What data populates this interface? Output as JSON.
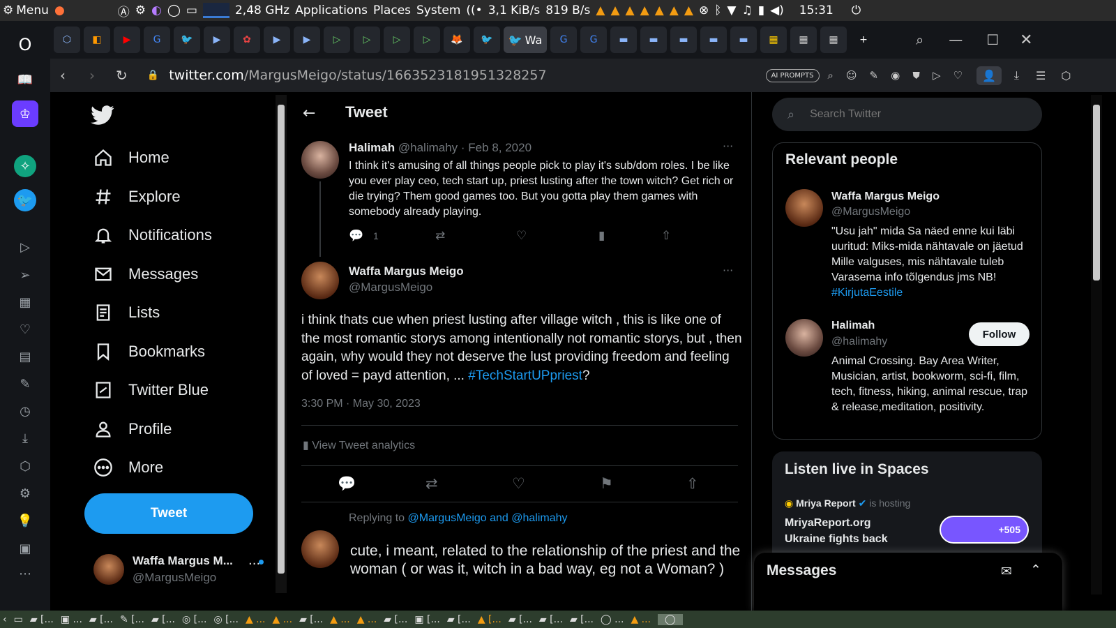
{
  "system_bar": {
    "menu": "Menu",
    "cpu": "2,48 GHz",
    "applications": "Applications",
    "places": "Places",
    "system": "System",
    "net_down": "3,1 KiB/s",
    "net_up": "819 B/s",
    "clock": "15:31"
  },
  "browser": {
    "url_host": "twitter.com",
    "url_path": "/MargusMeigo/status/1663523181951328257",
    "ai_prompts": "AI PROMPTS",
    "active_tab_title": "Wa"
  },
  "nav": {
    "items": [
      "Home",
      "Explore",
      "Notifications",
      "Messages",
      "Lists",
      "Bookmarks",
      "Twitter Blue",
      "Profile",
      "More"
    ],
    "tweet_button": "Tweet",
    "account_name": "Waffa Margus M...",
    "account_handle": "@MargusMeigo"
  },
  "header": {
    "title": "Tweet"
  },
  "parent_tweet": {
    "name": "Halimah",
    "handle": "@halimahy",
    "date": "Feb 8, 2020",
    "text": "I think it's amusing of all things people pick to play it's sub/dom roles. I be like you ever play ceo, tech start up, priest lusting after the town witch? Get rich or die trying? Them good games too. But you gotta play them games with somebody already playing.",
    "reply_count": "1"
  },
  "main_tweet": {
    "name": "Waffa Margus Meigo",
    "handle": "@MargusMeigo",
    "text": "i think thats cue when priest lusting after village witch , this is like one of the most romantic storys among intentionally not romantic storys, but , then again, why would they not deserve the lust providing freedom and feeling of loved = payd attention, ... ",
    "hashtag": "#TechStartUPpriest",
    "text_end": "?",
    "time": "3:30 PM · May 30, 2023",
    "analytics": "View Tweet analytics"
  },
  "reply": {
    "replying_to": "Replying to",
    "mentions": "@MargusMeigo and @halimahy",
    "draft": "cute, i meant, related to the relationship of the priest and the woman ( or was it, witch in a bad way, eg not a Woman? )"
  },
  "search": {
    "placeholder": "Search Twitter"
  },
  "relevant": {
    "title": "Relevant people",
    "people": [
      {
        "name": "Waffa Margus Meigo",
        "handle": "@MargusMeigo",
        "bio": "\"Usu jah\" mida Sa näed enne kui läbi uuritud: Miks-mida nähtavale on jäetud Mille valguses, mis nähtavale tuleb Varasema info tõlgendus jms NB! ",
        "bio_tag": "#KirjutaEestile"
      },
      {
        "name": "Halimah",
        "handle": "@halimahy",
        "follow": "Follow",
        "bio": "Animal Crossing. Bay Area Writer, Musician, artist, bookworm, sci-fi, film, tech, fitness, hiking, animal rescue, trap & release,meditation, positivity."
      }
    ]
  },
  "spaces": {
    "title": "Listen live in Spaces",
    "host": "Mriya Report",
    "hosting": "is hosting",
    "line1": "MriyaReport.org",
    "line2": "Ukraine fights back",
    "count": "+505"
  },
  "messages_drawer": {
    "title": "Messages"
  }
}
